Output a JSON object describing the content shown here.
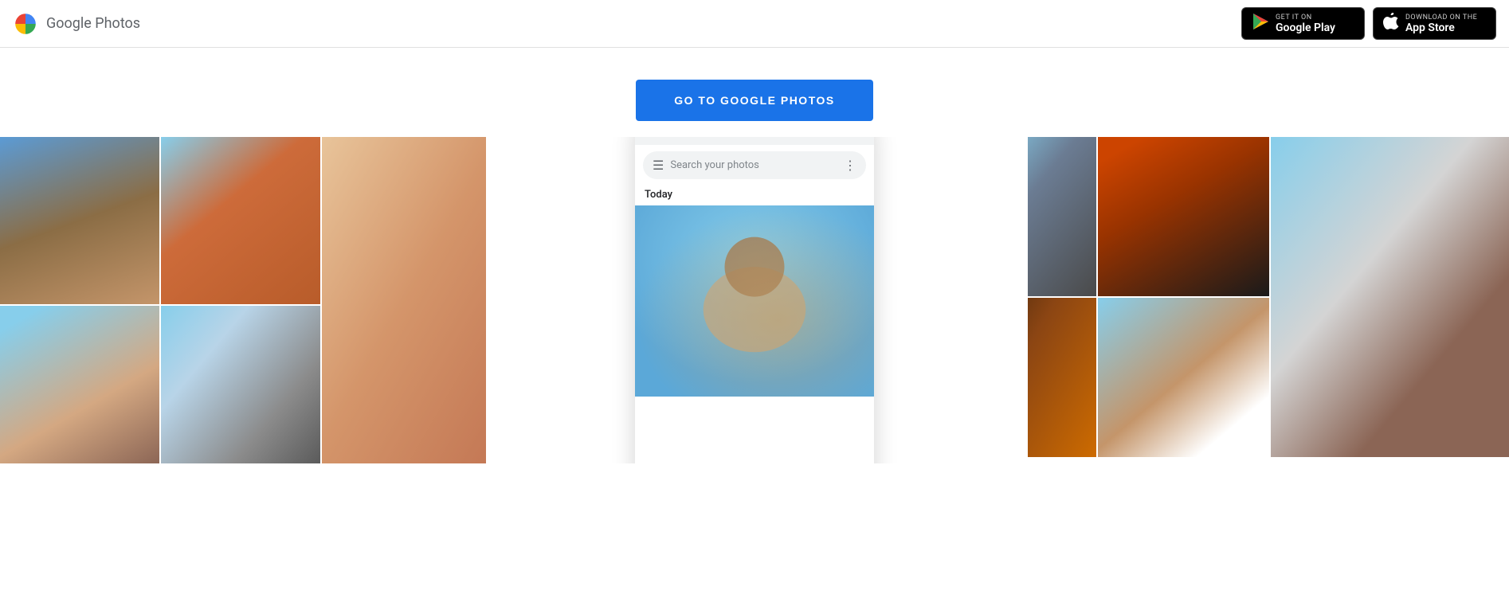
{
  "header": {
    "logo_text": "Google Photos",
    "google_play_sub": "GET IT ON",
    "google_play_name": "Google Play",
    "app_store_sub": "Download on the",
    "app_store_name": "App Store"
  },
  "cta": {
    "button_label": "GO TO GOOGLE PHOTOS"
  },
  "phone": {
    "search_placeholder": "Search your photos",
    "date_label": "Today"
  }
}
